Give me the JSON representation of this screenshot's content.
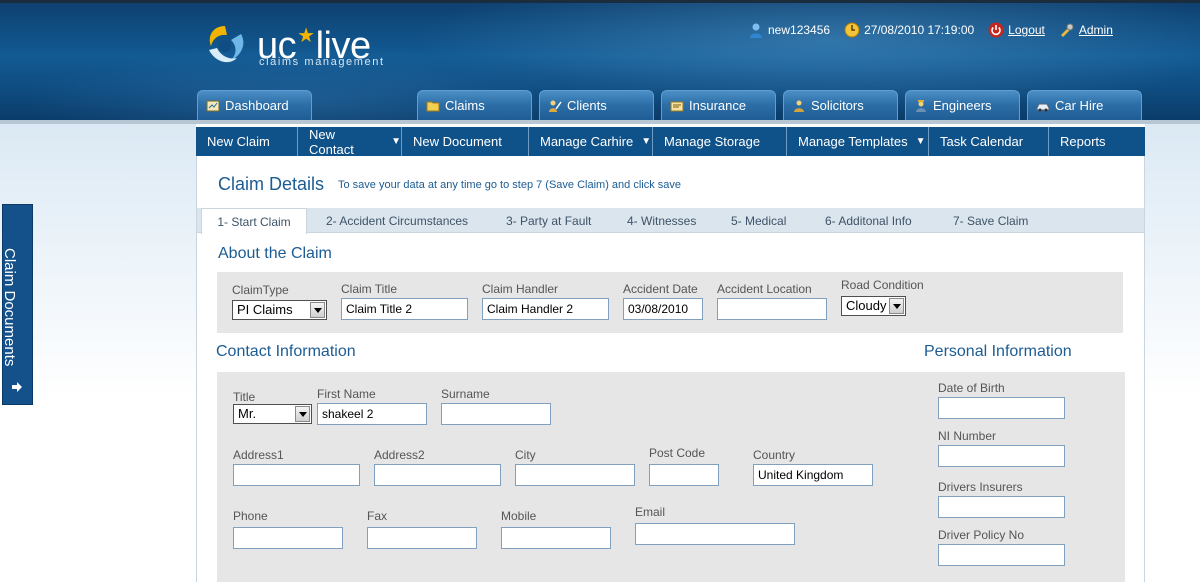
{
  "app": {
    "name_part1": "uc",
    "name_part2": "live",
    "subtitle": "claims management"
  },
  "userbar": {
    "username": "new123456",
    "datetime": "27/08/2010 17:19:00",
    "logout": "Logout",
    "admin": "Admin"
  },
  "main_tabs": [
    {
      "label": "Dashboard",
      "icon": "dashboard-icon"
    },
    {
      "label": "Claims",
      "icon": "folder-icon"
    },
    {
      "label": "Clients",
      "icon": "clients-icon"
    },
    {
      "label": "Insurance",
      "icon": "insurance-icon"
    },
    {
      "label": "Solicitors",
      "icon": "solicitors-icon"
    },
    {
      "label": "Engineers",
      "icon": "engineers-icon"
    },
    {
      "label": "Car Hire",
      "icon": "car-icon"
    }
  ],
  "submenu": [
    {
      "label": "New Claim",
      "caret": ""
    },
    {
      "label": "New Contact",
      "caret": "▼"
    },
    {
      "label": "New Document",
      "caret": ""
    },
    {
      "label": "Manage Carhire",
      "caret": "▼"
    },
    {
      "label": "Manage Storage",
      "caret": ""
    },
    {
      "label": "Manage Templates",
      "caret": "▼"
    },
    {
      "label": "Task Calendar",
      "caret": ""
    },
    {
      "label": "Reports",
      "caret": ""
    }
  ],
  "side_tab": {
    "label": "Claim Documents"
  },
  "page": {
    "title": "Claim Details",
    "hint": "To save your data at any time go to step 7 (Save Claim) and click save"
  },
  "steps": [
    "1- Start Claim",
    "2- Accident Circumstances",
    "3- Party at Fault",
    "4- Witnesses",
    "5- Medical",
    "6- Additonal Info",
    "7- Save Claim"
  ],
  "about": {
    "section_title": "About the Claim",
    "claim_type": {
      "label": "ClaimType",
      "value": "PI Claims"
    },
    "claim_title": {
      "label": "Claim Title",
      "value": "Claim Title 2"
    },
    "claim_handler": {
      "label": "Claim Handler",
      "value": "Claim Handler 2"
    },
    "accident_date": {
      "label": "Accident Date",
      "value": "03/08/2010"
    },
    "accident_location": {
      "label": "Accident Location",
      "value": ""
    },
    "road_condition": {
      "label": "Road Condition",
      "value": "Cloudy"
    }
  },
  "contact": {
    "section_title": "Contact Information",
    "title": {
      "label": "Title",
      "value": "Mr."
    },
    "first_name": {
      "label": "First Name",
      "value": "shakeel 2"
    },
    "surname": {
      "label": "Surname",
      "value": ""
    },
    "address1": {
      "label": "Address1",
      "value": ""
    },
    "address2": {
      "label": "Address2",
      "value": ""
    },
    "city": {
      "label": "City",
      "value": ""
    },
    "post_code": {
      "label": "Post Code",
      "value": ""
    },
    "country": {
      "label": "Country",
      "value": "United Kingdom"
    },
    "phone": {
      "label": "Phone",
      "value": ""
    },
    "fax": {
      "label": "Fax",
      "value": ""
    },
    "mobile": {
      "label": "Mobile",
      "value": ""
    },
    "email": {
      "label": "Email",
      "value": ""
    }
  },
  "personal": {
    "section_title": "Personal Information",
    "dob": {
      "label": "Date of Birth",
      "value": ""
    },
    "ni_number": {
      "label": "NI Number",
      "value": ""
    },
    "drivers_insurers": {
      "label": "Drivers Insurers",
      "value": ""
    },
    "driver_policy_no": {
      "label": "Driver Policy No",
      "value": ""
    }
  },
  "colors": {
    "header_blue": "#125a93",
    "submenu_blue": "#0f5189",
    "title_blue": "#1c5c93",
    "panel_grey": "#e6e6e6",
    "logo_accent": "#f2b400"
  }
}
